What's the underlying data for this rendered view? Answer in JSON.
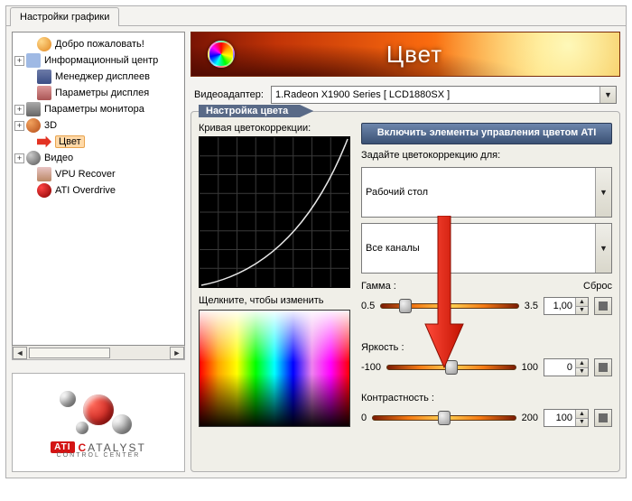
{
  "tab_title": "Настройки графики",
  "tree": {
    "items": [
      {
        "label": "Добро пожаловать!",
        "expandable": false
      },
      {
        "label": "Информационный центр",
        "expandable": true
      },
      {
        "label": "Менеджер дисплеев",
        "expandable": false
      },
      {
        "label": "Параметры дисплея",
        "expandable": false
      },
      {
        "label": "Параметры монитора",
        "expandable": true
      },
      {
        "label": "3D",
        "expandable": true
      },
      {
        "label": "Цвет",
        "expandable": false,
        "selected": true
      },
      {
        "label": "Видео",
        "expandable": true
      },
      {
        "label": "VPU Recover",
        "expandable": false
      },
      {
        "label": "ATI Overdrive",
        "expandable": false
      }
    ]
  },
  "logo": {
    "badge": "ATI",
    "brand_html": "CATALYST",
    "sub": "CONTROL CENTER"
  },
  "banner": {
    "title": "Цвет"
  },
  "adapter": {
    "label": "Видеоадаптер:",
    "value": "1.Radeon X1900 Series [ LCD1880SX ]"
  },
  "group": {
    "legend": "Настройка цвета",
    "curve_label": "Кривая цветокоррекции:",
    "spectrum_label": "Щелкните, чтобы изменить",
    "enable_button": "Включить элементы управления цветом ATI",
    "color_for_label": "Задайте цветокоррекцию для:",
    "color_for_combo": "Рабочий стол",
    "channel_combo": "Все каналы",
    "reset_label": "Сброс",
    "gamma": {
      "label": "Гамма :",
      "min": "0.5",
      "max": "3.5",
      "value": "1,00",
      "pos": 18
    },
    "bright": {
      "label": "Яркость :",
      "min": "-100",
      "max": "100",
      "value": "0",
      "pos": 50
    },
    "contr": {
      "label": "Контрастность :",
      "min": "0",
      "max": "200",
      "value": "100",
      "pos": 50
    }
  }
}
